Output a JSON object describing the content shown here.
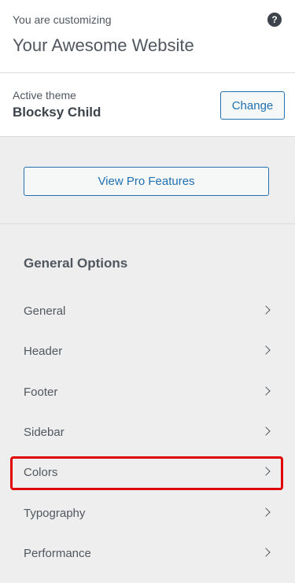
{
  "header": {
    "customizing_label": "You are customizing",
    "site_title": "Your Awesome Website",
    "help_icon_glyph": "?"
  },
  "theme": {
    "label": "Active theme",
    "name": "Blocksy Child",
    "change_label": "Change"
  },
  "pro": {
    "label": "View Pro Features"
  },
  "section": {
    "title": "General Options",
    "items": [
      {
        "label": "General"
      },
      {
        "label": "Header"
      },
      {
        "label": "Footer"
      },
      {
        "label": "Sidebar"
      },
      {
        "label": "Colors",
        "highlighted": true
      },
      {
        "label": "Typography"
      },
      {
        "label": "Performance"
      }
    ]
  },
  "colors": {
    "accent": "#2271b1",
    "highlight": "#e00000"
  }
}
